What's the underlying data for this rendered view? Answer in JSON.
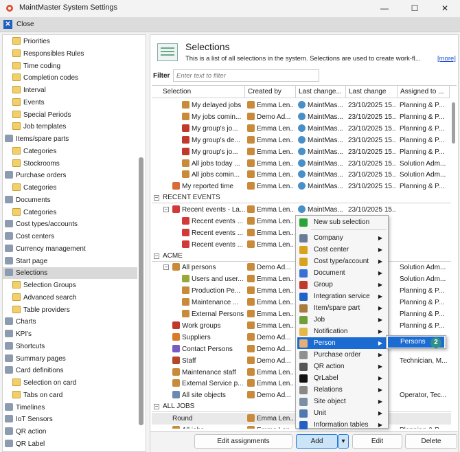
{
  "window": {
    "title": "MaintMaster System Settings",
    "minimize_glyph": "—",
    "maximize_glyph": "☐",
    "close_glyph": "✕",
    "app_icon": "gear-app-icon"
  },
  "closebar": {
    "label": "Close",
    "icon": "close-icon"
  },
  "tree": {
    "items": [
      {
        "label": "Priorities",
        "indent": 1,
        "icon": "folder-icon"
      },
      {
        "label": "Responsibles Rules",
        "indent": 1,
        "icon": "folder-icon"
      },
      {
        "label": "Time coding",
        "indent": 1,
        "icon": "folder-icon"
      },
      {
        "label": "Completion codes",
        "indent": 1,
        "icon": "folder-icon"
      },
      {
        "label": "Interval",
        "indent": 1,
        "icon": "folder-icon"
      },
      {
        "label": "Events",
        "indent": 1,
        "icon": "folder-icon"
      },
      {
        "label": "Special Periods",
        "indent": 1,
        "icon": "folder-icon"
      },
      {
        "label": "Job templates",
        "indent": 1,
        "icon": "folder-icon"
      },
      {
        "label": "Items/spare parts",
        "indent": 0,
        "icon": "spare-parts-icon"
      },
      {
        "label": "Categories",
        "indent": 1,
        "icon": "folder-icon"
      },
      {
        "label": "Stockrooms",
        "indent": 1,
        "icon": "folder-icon"
      },
      {
        "label": "Purchase orders",
        "indent": 0,
        "icon": "purchase-order-icon"
      },
      {
        "label": "Categories",
        "indent": 1,
        "icon": "folder-icon"
      },
      {
        "label": "Documents",
        "indent": 0,
        "icon": "documents-icon"
      },
      {
        "label": "Categories",
        "indent": 1,
        "icon": "folder-icon"
      },
      {
        "label": "Cost types/accounts",
        "indent": 0,
        "icon": "cost-types-icon"
      },
      {
        "label": "Cost centers",
        "indent": 0,
        "icon": "cost-centers-icon"
      },
      {
        "label": "Currency management",
        "indent": 0,
        "icon": "currency-icon"
      },
      {
        "label": "Start page",
        "indent": 0,
        "icon": "start-page-icon"
      },
      {
        "label": "Selections",
        "indent": 0,
        "icon": "selections-icon",
        "selected": true
      },
      {
        "label": "Selection Groups",
        "indent": 1,
        "icon": "folder-icon"
      },
      {
        "label": "Advanced search",
        "indent": 1,
        "icon": "folder-icon"
      },
      {
        "label": "Table providers",
        "indent": 1,
        "icon": "folder-icon"
      },
      {
        "label": "Charts",
        "indent": 0,
        "icon": "charts-icon"
      },
      {
        "label": "KPI's",
        "indent": 0,
        "icon": "kpi-icon"
      },
      {
        "label": "Shortcuts",
        "indent": 0,
        "icon": "shortcuts-icon"
      },
      {
        "label": "Summary pages",
        "indent": 0,
        "icon": "summary-pages-icon"
      },
      {
        "label": "Card definitions",
        "indent": 0,
        "icon": "card-definitions-icon"
      },
      {
        "label": "Selection on card",
        "indent": 1,
        "icon": "folder-icon"
      },
      {
        "label": "Tabs on card",
        "indent": 1,
        "icon": "folder-icon"
      },
      {
        "label": "Timelines",
        "indent": 0,
        "icon": "timelines-icon"
      },
      {
        "label": "IoT Sensors",
        "indent": 0,
        "icon": "iot-sensors-icon"
      },
      {
        "label": "QR action",
        "indent": 0,
        "icon": "qr-action-icon"
      },
      {
        "label": "QR Label",
        "indent": 0,
        "icon": "qr-label-icon"
      }
    ]
  },
  "header": {
    "title": "Selections",
    "description": "This is a list of all selections in the system. Selections are used to create work-fl...",
    "more_link": "[more]",
    "icon": "selections-list-icon"
  },
  "filter": {
    "label": "Filter",
    "placeholder": "Enter text to filter"
  },
  "grid": {
    "columns": [
      "Selection",
      "Created by",
      "Last change...",
      "Last change",
      "Assigned to ..."
    ],
    "rows": [
      {
        "type": "row",
        "indent": 2,
        "icon": "person-icon",
        "cells": [
          "My delayed jobs",
          "Emma Len...",
          "MaintMas...",
          "23/10/2025 15...",
          "Planning & P..."
        ]
      },
      {
        "type": "row",
        "indent": 2,
        "icon": "person-icon",
        "cells": [
          "My jobs comin...",
          "Demo Ad...",
          "MaintMas...",
          "23/10/2025 15...",
          "Planning & P..."
        ]
      },
      {
        "type": "row",
        "indent": 2,
        "icon": "group-icon",
        "cells": [
          "My group's jo...",
          "Emma Len...",
          "MaintMas...",
          "23/10/2025 15...",
          "Planning & P..."
        ]
      },
      {
        "type": "row",
        "indent": 2,
        "icon": "group-icon",
        "cells": [
          "My group's de...",
          "Emma Len...",
          "MaintMas...",
          "23/10/2025 15...",
          "Planning & P..."
        ]
      },
      {
        "type": "row",
        "indent": 2,
        "icon": "group-icon",
        "cells": [
          "My group's jo...",
          "Emma Len...",
          "MaintMas...",
          "23/10/2025 15...",
          "Planning & P..."
        ]
      },
      {
        "type": "row",
        "indent": 2,
        "icon": "person-icon",
        "cells": [
          "All jobs today ...",
          "Emma Len...",
          "MaintMas...",
          "23/10/2025 15...",
          "Solution Adm..."
        ]
      },
      {
        "type": "row",
        "indent": 2,
        "icon": "person-icon",
        "cells": [
          "All jobs comin...",
          "Emma Len...",
          "MaintMas...",
          "23/10/2025 15...",
          "Solution Adm..."
        ]
      },
      {
        "type": "row",
        "indent": 1,
        "icon": "reported-icon",
        "cells": [
          "My reported time",
          "Emma Len...",
          "MaintMas...",
          "23/10/2025 15...",
          "Planning & P..."
        ]
      },
      {
        "type": "group",
        "label": "RECENT EVENTS"
      },
      {
        "type": "row",
        "indent": 1,
        "icon": "flag-icon",
        "expander": "−",
        "cells": [
          "Recent events - La...",
          "Emma Len...",
          "MaintMas...",
          "23/10/2025 15...",
          ""
        ]
      },
      {
        "type": "row",
        "indent": 2,
        "icon": "flag-icon",
        "cells": [
          "Recent events ...",
          "Emma Len...",
          "",
          "",
          ""
        ]
      },
      {
        "type": "row",
        "indent": 2,
        "icon": "flag-icon",
        "cells": [
          "Recent events ...",
          "Emma Len...",
          "",
          "",
          ""
        ]
      },
      {
        "type": "row",
        "indent": 2,
        "icon": "flag-icon",
        "cells": [
          "Recent events ...",
          "Emma Len...",
          "",
          "",
          ""
        ]
      },
      {
        "type": "group",
        "label": "ACME"
      },
      {
        "type": "row",
        "indent": 1,
        "icon": "persons-icon",
        "expander": "−",
        "cells": [
          "All persons",
          "Demo Ad...",
          "",
          "",
          "Solution Adm..."
        ]
      },
      {
        "type": "row",
        "indent": 2,
        "icon": "shield-icon",
        "cells": [
          "Users and user...",
          "Emma Len...",
          "",
          "",
          "Solution Adm..."
        ]
      },
      {
        "type": "row",
        "indent": 2,
        "icon": "person-icon",
        "cells": [
          "Production Pe...",
          "Emma Len...",
          "",
          "",
          "Planning & P..."
        ]
      },
      {
        "type": "row",
        "indent": 2,
        "icon": "person-icon",
        "cells": [
          "Maintenance ...",
          "Emma Len...",
          "",
          "",
          "Planning & P..."
        ]
      },
      {
        "type": "row",
        "indent": 2,
        "icon": "person-icon",
        "cells": [
          "External Persons",
          "Emma Len...",
          "",
          "",
          "Planning & P..."
        ]
      },
      {
        "type": "row",
        "indent": 1,
        "icon": "work-group-icon",
        "cells": [
          "Work groups",
          "Emma Len...",
          "",
          "",
          "Planning & P..."
        ]
      },
      {
        "type": "row",
        "indent": 1,
        "icon": "supplier-icon",
        "cells": [
          "Suppliers",
          "Demo Ad...",
          "",
          "",
          ""
        ]
      },
      {
        "type": "row",
        "indent": 1,
        "icon": "contact-icon",
        "cells": [
          "Contact Persons",
          "Demo Ad...",
          "",
          "",
          ""
        ]
      },
      {
        "type": "row",
        "indent": 1,
        "icon": "staff-icon",
        "cells": [
          "Staff",
          "Demo Ad...",
          "",
          "",
          "Technician, M..."
        ]
      },
      {
        "type": "row",
        "indent": 1,
        "icon": "person-icon",
        "cells": [
          "Maintenance staff",
          "Emma Len...",
          "",
          "",
          ""
        ]
      },
      {
        "type": "row",
        "indent": 1,
        "icon": "person-icon",
        "cells": [
          "External Service p...",
          "Emma Len...",
          "",
          "",
          ""
        ]
      },
      {
        "type": "row",
        "indent": 1,
        "icon": "site-icon",
        "cells": [
          "All site objects",
          "Demo Ad...",
          "",
          "",
          "Operator, Tec..."
        ]
      },
      {
        "type": "group",
        "label": "ALL JOBS"
      },
      {
        "type": "row",
        "indent": 1,
        "icon": "",
        "cells": [
          "Round",
          "Emma Len...",
          "",
          "",
          ""
        ]
      },
      {
        "type": "row",
        "indent": 1,
        "icon": "person-icon",
        "cells": [
          "All jobs",
          "Emma Len...",
          "",
          "",
          "Planning & P..."
        ]
      }
    ]
  },
  "buttons": {
    "edit_assignments": "Edit assignments",
    "add": "Add",
    "add_dropdown": "▾",
    "edit": "Edit",
    "delete": "Delete"
  },
  "context_menu": {
    "items": [
      {
        "label": "New sub selection",
        "icon": "plus-icon",
        "arrow": false,
        "color": "#2aa33a"
      },
      {
        "label": "Company",
        "icon": "company-icon",
        "arrow": true,
        "color": "#6b7c99"
      },
      {
        "label": "Cost center",
        "icon": "cost-center-icon",
        "arrow": true,
        "color": "#d9a21e"
      },
      {
        "label": "Cost type/account",
        "icon": "cost-type-icon",
        "arrow": true,
        "color": "#d9a21e"
      },
      {
        "label": "Document",
        "icon": "document-icon",
        "arrow": true,
        "color": "#3b6fd6"
      },
      {
        "label": "Group",
        "icon": "group-icon",
        "arrow": true,
        "color": "#c0392b"
      },
      {
        "label": "Integration service",
        "icon": "integration-icon",
        "arrow": true,
        "color": "#1e63c9"
      },
      {
        "label": "Item/spare part",
        "icon": "item-icon",
        "arrow": true,
        "color": "#a87a3c"
      },
      {
        "label": "Job",
        "icon": "job-icon",
        "arrow": true,
        "color": "#6f9e3a"
      },
      {
        "label": "Notification",
        "icon": "notification-icon",
        "arrow": true,
        "color": "#e5b84a"
      },
      {
        "label": "Person",
        "icon": "person-icon",
        "arrow": true,
        "active": true,
        "color": "#e2b07a"
      },
      {
        "label": "Purchase order",
        "icon": "purchase-order-icon",
        "arrow": true,
        "color": "#8f8f8f"
      },
      {
        "label": "QR action",
        "icon": "qr-action-icon",
        "arrow": true,
        "color": "#555555"
      },
      {
        "label": "QrLabel",
        "icon": "qr-label-icon",
        "arrow": true,
        "color": "#111111"
      },
      {
        "label": "Relations",
        "icon": "relations-icon",
        "arrow": true,
        "color": "#888888"
      },
      {
        "label": "Site object",
        "icon": "site-object-icon",
        "arrow": true,
        "color": "#7a8fa3"
      },
      {
        "label": "Unit",
        "icon": "unit-icon",
        "arrow": true,
        "color": "#4f78b0"
      },
      {
        "label": "Information tables",
        "icon": "information-icon",
        "arrow": true,
        "color": "#2260c4"
      }
    ]
  },
  "submenu": {
    "label": "Persons",
    "badge": "2"
  }
}
